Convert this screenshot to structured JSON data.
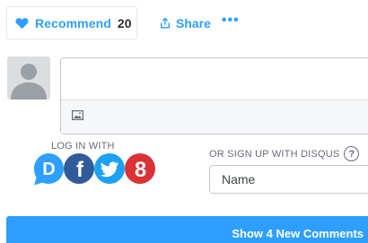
{
  "toolbar": {
    "recommend_label": "Recommend",
    "recommend_count": "20",
    "share_label": "Share",
    "more_label": "•••"
  },
  "composer": {
    "placeholder": ""
  },
  "login": {
    "label": "LOG IN WITH",
    "providers": [
      {
        "name": "disqus",
        "glyph": "D",
        "color": "#2e9fff"
      },
      {
        "name": "facebook",
        "glyph": "f",
        "color": "#305c99"
      },
      {
        "name": "twitter",
        "glyph": "twitter-bird",
        "color": "#1da1f2"
      },
      {
        "name": "google",
        "glyph": "8",
        "color": "#db3236"
      }
    ]
  },
  "signup": {
    "label": "OR SIGN UP WITH DISQUS",
    "help_glyph": "?",
    "name_placeholder": "Name"
  },
  "new_comments": {
    "label": "Show 4 New Comments"
  },
  "colors": {
    "accent": "#2e9fff",
    "facebook": "#305c99",
    "twitter": "#1da1f2",
    "google": "#db3236"
  }
}
